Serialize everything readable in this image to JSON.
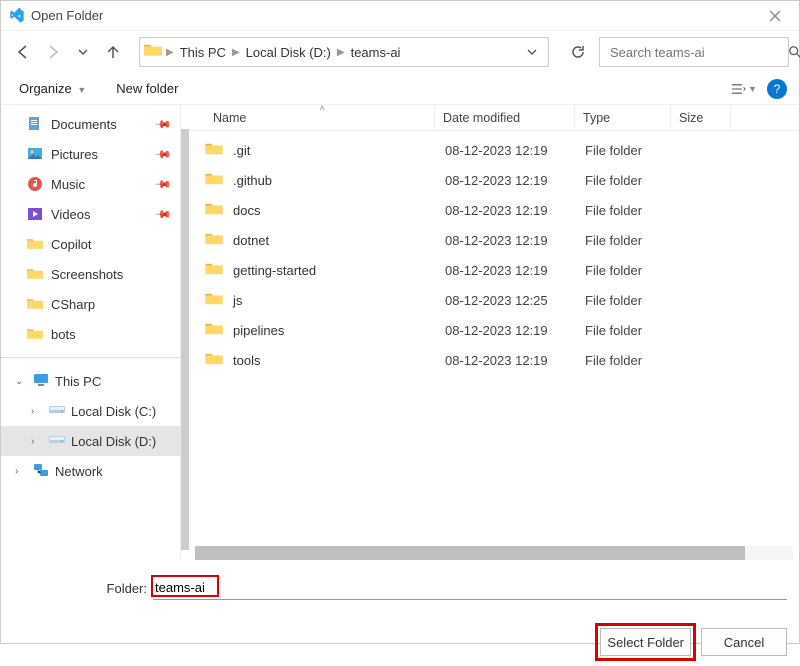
{
  "title": "Open Folder",
  "breadcrumb": {
    "seg1": "This PC",
    "seg2": "Local Disk (D:)",
    "seg3": "teams-ai"
  },
  "search": {
    "placeholder": "Search teams-ai"
  },
  "toolbar": {
    "organize": "Organize",
    "newfolder": "New folder"
  },
  "quick": [
    {
      "label": "Documents",
      "icon": "doc"
    },
    {
      "label": "Pictures",
      "icon": "pic"
    },
    {
      "label": "Music",
      "icon": "music"
    },
    {
      "label": "Videos",
      "icon": "video"
    },
    {
      "label": "Copilot",
      "icon": "folder"
    },
    {
      "label": "Screenshots",
      "icon": "folder"
    },
    {
      "label": "CSharp",
      "icon": "folder"
    },
    {
      "label": "bots",
      "icon": "folder"
    }
  ],
  "tree": {
    "thispc": "This PC",
    "drivec": "Local Disk (C:)",
    "drived": "Local Disk (D:)",
    "network": "Network"
  },
  "columns": {
    "name": "Name",
    "date": "Date modified",
    "type": "Type",
    "size": "Size"
  },
  "filetype": "File folder",
  "files": [
    {
      "name": ".git",
      "date": "08-12-2023 12:19"
    },
    {
      "name": ".github",
      "date": "08-12-2023 12:19"
    },
    {
      "name": "docs",
      "date": "08-12-2023 12:19"
    },
    {
      "name": "dotnet",
      "date": "08-12-2023 12:19"
    },
    {
      "name": "getting-started",
      "date": "08-12-2023 12:19"
    },
    {
      "name": "js",
      "date": "08-12-2023 12:25"
    },
    {
      "name": "pipelines",
      "date": "08-12-2023 12:19"
    },
    {
      "name": "tools",
      "date": "08-12-2023 12:19"
    }
  ],
  "footer": {
    "label": "Folder:",
    "value": "teams-ai",
    "select": "Select Folder",
    "cancel": "Cancel"
  }
}
